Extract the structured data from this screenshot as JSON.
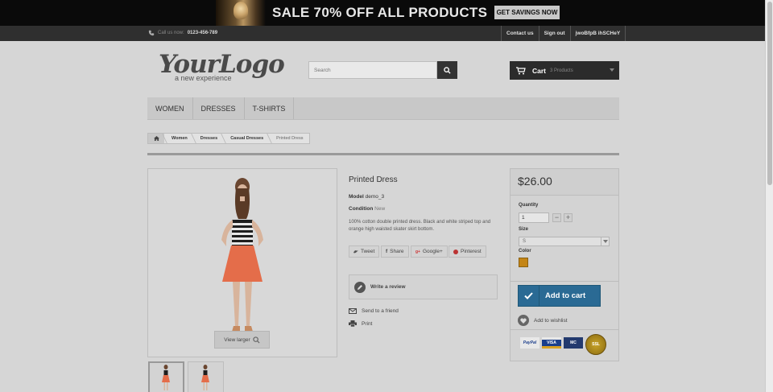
{
  "banner": {
    "sale_text": "SALE 70% OFF ALL PRODUCTS",
    "cta_label": "GET SAVINGS NOW"
  },
  "topnav": {
    "call_label": "Call us now:",
    "phone": "0123-456-789",
    "links": [
      "Contact us",
      "Sign out",
      "jwoBfpB ihSCHeY"
    ]
  },
  "header": {
    "logo_text": "YourLogo",
    "logo_tagline": "a new experience",
    "search_placeholder": "Search",
    "cart_label": "Cart",
    "cart_count": "3 Products"
  },
  "menu": {
    "items": [
      "WOMEN",
      "DRESSES",
      "T-SHIRTS"
    ]
  },
  "breadcrumb": {
    "items": [
      "Women",
      "Dresses",
      "Casual Dresses",
      "Printed Dress"
    ]
  },
  "product": {
    "view_larger": "View larger",
    "name": "Printed Dress",
    "model_label": "Model",
    "model_value": "demo_3",
    "condition_label": "Condition",
    "condition_value": "New",
    "description": "100% cotton double printed dress. Black and white striped top and orange high waisted skater skirt bottom.",
    "share": [
      "Tweet",
      "Share",
      "Google+",
      "Pinterest"
    ],
    "write_review": "Write a review",
    "send_friend": "Send to a friend",
    "print": "Print"
  },
  "buybox": {
    "price": "$26.00",
    "quantity_label": "Quantity",
    "quantity_value": "1",
    "size_label": "Size",
    "size_value": "S",
    "color_label": "Color",
    "color_swatch": "#c48516",
    "add_to_cart": "Add to cart",
    "add_to_wishlist": "Add to wishlist",
    "payments": [
      "PayPal",
      "VISA",
      "MC"
    ],
    "seal_text": "SSL"
  }
}
